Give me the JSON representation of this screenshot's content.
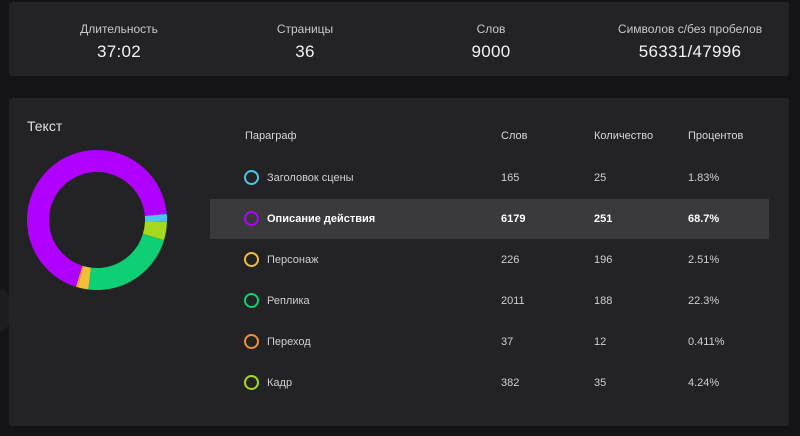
{
  "stats": [
    {
      "label": "Длительность",
      "value": "37:02"
    },
    {
      "label": "Страницы",
      "value": "36"
    },
    {
      "label": "Слов",
      "value": "9000"
    },
    {
      "label": "Символов с/без пробелов",
      "value": "56331/47996"
    }
  ],
  "text_section": {
    "title": "Текст",
    "headers": {
      "paragraph": "Параграф",
      "words": "Слов",
      "count": "Количество",
      "percent": "Процентов"
    },
    "rows": [
      {
        "name": "Заголовок сцены",
        "words": "165",
        "count": "25",
        "percent": "1.83%",
        "color": "#4cc3f0",
        "selected": false
      },
      {
        "name": "Описание действия",
        "words": "6179",
        "count": "251",
        "percent": "68.7%",
        "color": "#b000ff",
        "selected": true
      },
      {
        "name": "Персонаж",
        "words": "226",
        "count": "196",
        "percent": "2.51%",
        "color": "#f2bd3a",
        "selected": false
      },
      {
        "name": "Реплика",
        "words": "2011",
        "count": "188",
        "percent": "22.3%",
        "color": "#0fcf74",
        "selected": false
      },
      {
        "name": "Переход",
        "words": "37",
        "count": "12",
        "percent": "0.411%",
        "color": "#f0913a",
        "selected": false
      },
      {
        "name": "Кадр",
        "words": "382",
        "count": "35",
        "percent": "4.24%",
        "color": "#a6d81d",
        "selected": false
      }
    ]
  },
  "chart_data": {
    "type": "pie",
    "categories": [
      "Заголовок сцены",
      "Описание действия",
      "Персонаж",
      "Реплика",
      "Переход",
      "Кадр"
    ],
    "values": [
      1.83,
      68.7,
      2.51,
      22.3,
      0.411,
      4.24
    ],
    "colors": [
      "#4cc3f0",
      "#b000ff",
      "#f2bd3a",
      "#0fcf74",
      "#f0913a",
      "#a6d81d"
    ],
    "title": "Текст"
  }
}
